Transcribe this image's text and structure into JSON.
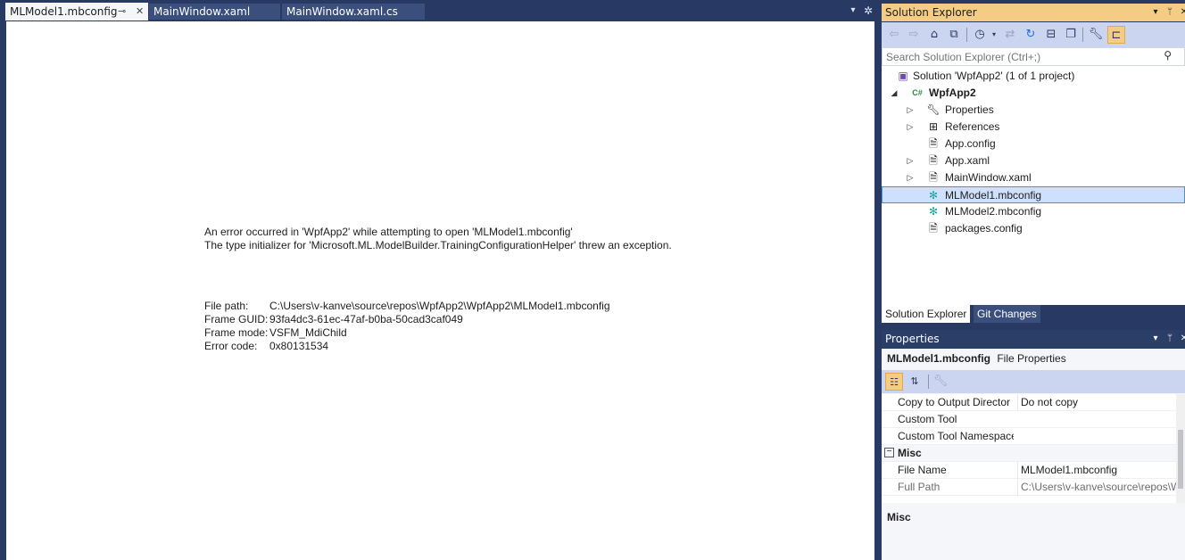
{
  "editor": {
    "tabs": [
      {
        "label": "MLModel1.mbconfig",
        "pin": "⊸",
        "close": "✕"
      },
      {
        "label": "MainWindow.xaml"
      },
      {
        "label": "MainWindow.xaml.cs"
      }
    ],
    "dropdown_icon": "chevron-down-icon",
    "settings_icon": "gear-icon",
    "error": {
      "line1": "An error occurred in 'WpfApp2' while attempting to open 'MLModel1.mbconfig'",
      "line2": "The type initializer for 'Microsoft.ML.ModelBuilder.TrainingConfigurationHelper' threw an exception.",
      "details": [
        {
          "label": "File path:",
          "value": "C:\\Users\\v-kanve\\source\\repos\\WpfApp2\\WpfApp2\\MLModel1.mbconfig"
        },
        {
          "label": "Frame GUID:",
          "value": "93fa4dc3-61ec-47af-b0ba-50cad3caf049"
        },
        {
          "label": "Frame mode:",
          "value": "VSFM_MdiChild"
        },
        {
          "label": "Error code:",
          "value": "0x80131534"
        }
      ]
    }
  },
  "solution_explorer": {
    "title": "Solution Explorer",
    "search_placeholder": "Search Solution Explorer (Ctrl+;)",
    "toolbar_icons": [
      "back-icon",
      "forward-icon",
      "home-icon",
      "switch-views-icon",
      "pending-changes-filter-icon",
      "sync-icon",
      "refresh-icon",
      "collapse-all-icon",
      "show-all-files-icon",
      "properties-icon",
      "preview-selected-icon"
    ],
    "tree": [
      {
        "label": "Solution 'WpfApp2' (1 of 1 project)",
        "icon": "solution-icon"
      },
      {
        "label": "WpfApp2",
        "icon": "csharp-project-icon",
        "expanded": true
      },
      {
        "label": "Properties",
        "icon": "wrench-icon"
      },
      {
        "label": "References",
        "icon": "references-icon"
      },
      {
        "label": "App.config",
        "icon": "config-file-icon"
      },
      {
        "label": "App.xaml",
        "icon": "xaml-file-icon"
      },
      {
        "label": "MainWindow.xaml",
        "icon": "xaml-file-icon"
      },
      {
        "label": "MLModel1.mbconfig",
        "icon": "mbconfig-icon",
        "selected": true
      },
      {
        "label": "MLModel2.mbconfig",
        "icon": "mbconfig-icon"
      },
      {
        "label": "packages.config",
        "icon": "config-file-icon"
      }
    ],
    "bottom_tabs": [
      "Solution Explorer",
      "Git Changes"
    ]
  },
  "properties": {
    "title": "Properties",
    "object_name": "MLModel1.mbconfig",
    "object_type": "File Properties",
    "rows": [
      {
        "name": "Copy to Output Director",
        "value": "Do not copy"
      },
      {
        "name": "Custom Tool",
        "value": ""
      },
      {
        "name": "Custom Tool Namespace",
        "value": ""
      }
    ],
    "category": "Misc",
    "misc_rows": [
      {
        "name": "File Name",
        "value": "MLModel1.mbconfig"
      },
      {
        "name": "Full Path",
        "value": "C:\\Users\\v-kanve\\source\\repos\\W"
      }
    ],
    "description_title": "Misc"
  },
  "colors": {
    "accent": "#f5cc84",
    "chrome": "#283a63",
    "selection": "#cfe0fc"
  }
}
